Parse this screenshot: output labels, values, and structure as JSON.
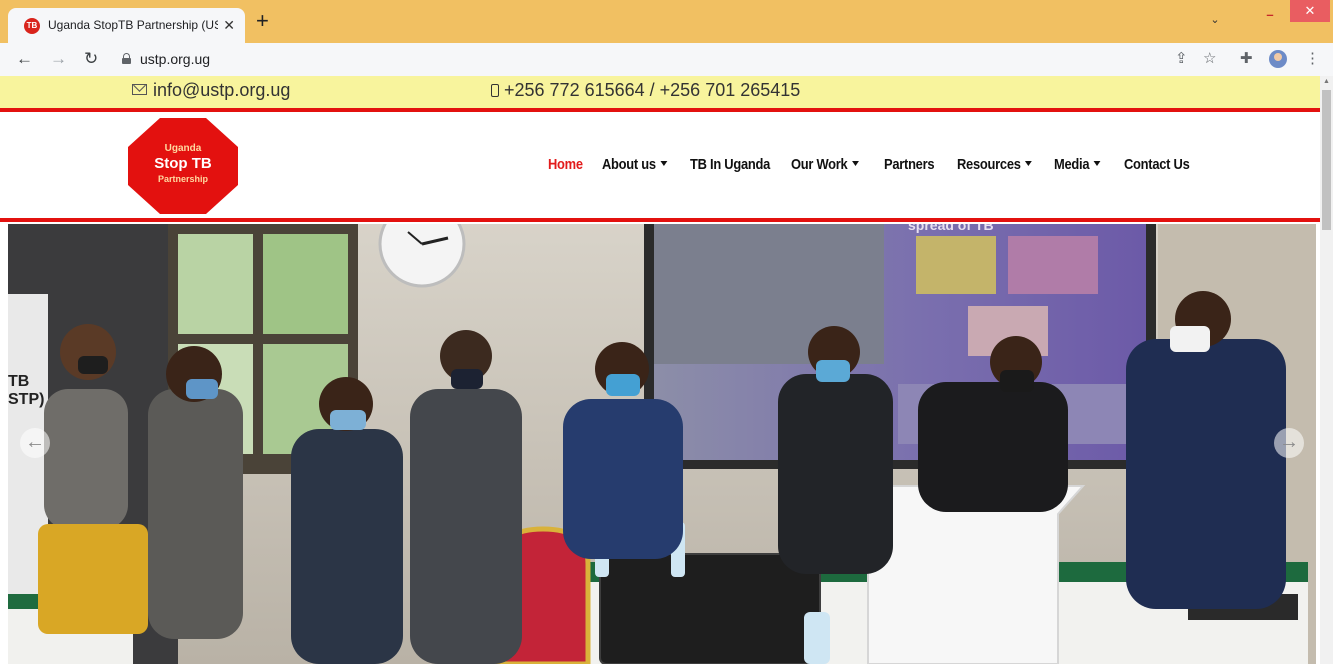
{
  "browser": {
    "tab_title": "Uganda StopTB Partnership (UST",
    "tab_close": "✕",
    "new_tab": "+",
    "url": "ustp.org.ug",
    "window_min": "–",
    "window_max": "❐",
    "window_close": "✕",
    "tab_menu": "⌄"
  },
  "topbar": {
    "email": "info@ustp.org.ug",
    "phones": "+256 772 615664 / +256 701 265415"
  },
  "logo": {
    "line1": "Uganda",
    "line2": "Stop TB",
    "line3": "Partnership",
    "color": "#e3110f"
  },
  "nav": {
    "home": "Home",
    "about": "About us",
    "tb_in_uganda": "TB In Uganda",
    "our_work": "Our Work",
    "partners": "Partners",
    "resources": "Resources",
    "media": "Media",
    "contact": "Contact Us"
  },
  "hero": {
    "banner_text": "TB\nSTP)",
    "slide_text": "spread of TB",
    "prev_label": "←",
    "next_label": "→"
  },
  "colors": {
    "topbar_bg": "#f8f49d",
    "accent_red": "#e3110f",
    "chrome_tabbar": "#f1c062"
  }
}
